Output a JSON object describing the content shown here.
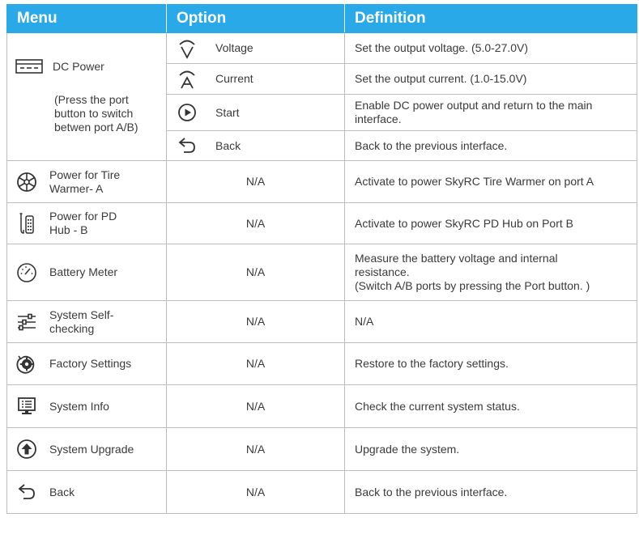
{
  "header": {
    "menu": "Menu",
    "option": "Option",
    "definition": "Definition"
  },
  "dc_power": {
    "label": "DC Power",
    "note": "(Press the port\nbutton to switch\nbetwen port A/B)",
    "icon": "dc-power-icon",
    "options": [
      {
        "label": "Voltage",
        "icon": "voltage-icon",
        "definition": "Set the output voltage. (5.0-27.0V)"
      },
      {
        "label": "Current",
        "icon": "current-icon",
        "definition": "Set the output current. (1.0-15.0V)"
      },
      {
        "label": "Start",
        "icon": "start-icon",
        "definition": "Enable DC power output and return to the main\ninterface."
      },
      {
        "label": "Back",
        "icon": "back-icon",
        "definition": "Back to the previous interface."
      }
    ]
  },
  "rows": [
    {
      "label": "Power for Tire\nWarmer- A",
      "icon": "tire-warmer-icon",
      "option": "N/A",
      "definition": "Activate to power SkyRC Tire Warmer on port A"
    },
    {
      "label": "Power for PD\nHub - B",
      "icon": "pd-hub-icon",
      "option": "N/A",
      "definition": "Activate to power SkyRC PD Hub on Port B"
    },
    {
      "label": "Battery Meter",
      "icon": "battery-meter-icon",
      "option": "N/A",
      "definition": "Measure the battery voltage and internal\nresistance.\n(Switch A/B ports by pressing the Port button. )"
    },
    {
      "label": "System Self-\nchecking",
      "icon": "sliders-icon",
      "option": "N/A",
      "definition": "N/A"
    },
    {
      "label": "Factory Settings",
      "icon": "factory-settings-icon",
      "option": "N/A",
      "definition": "Restore to the factory settings."
    },
    {
      "label": "System Info",
      "icon": "monitor-icon",
      "option": "N/A",
      "definition": "Check the current system status."
    },
    {
      "label": "System Upgrade",
      "icon": "upgrade-icon",
      "option": "N/A",
      "definition": "Upgrade the system."
    },
    {
      "label": "Back",
      "icon": "back-icon",
      "option": "N/A",
      "definition": "Back to the previous interface."
    }
  ],
  "colors": {
    "header_bg": "#29a9e8",
    "header_text": "#ffffff",
    "border": "#bdbdbd",
    "icon": "#333333"
  }
}
